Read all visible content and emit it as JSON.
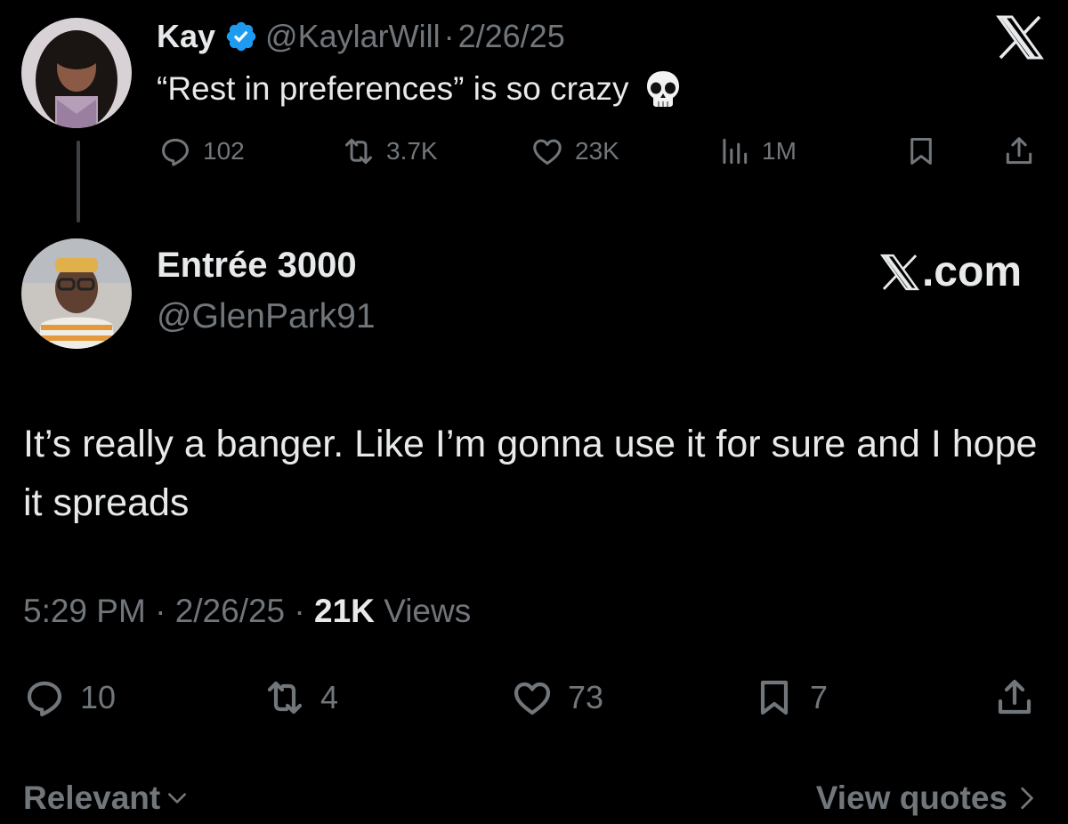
{
  "parent_tweet": {
    "author_name": "Kay",
    "handle": "@KaylarWill",
    "separator": "·",
    "date": "2/26/25",
    "text": "“Rest in preferences” is so crazy",
    "emoji": "skull-icon",
    "actions": {
      "replies": "102",
      "reposts": "3.7K",
      "likes": "23K",
      "views": "1M"
    }
  },
  "reply_tweet": {
    "author_name": "Entrée 3000",
    "handle": "@GlenPark91",
    "watermark": ".com",
    "text": "It’s really a banger. Like I’m gonna use it for sure and I hope it spreads",
    "time": "5:29 PM",
    "sep1": " · ",
    "date": "2/26/25",
    "sep2": " · ",
    "views_count": "21K",
    "views_label": " Views",
    "actions": {
      "replies": "10",
      "reposts": "4",
      "likes": "73",
      "bookmarks": "7"
    }
  },
  "footer": {
    "sort_label": "Relevant",
    "quotes_label": "View quotes"
  },
  "colors": {
    "background": "#000000",
    "text_primary": "#e7e9ea",
    "text_muted": "#71767b",
    "verified_blue": "#1d9bf0"
  }
}
